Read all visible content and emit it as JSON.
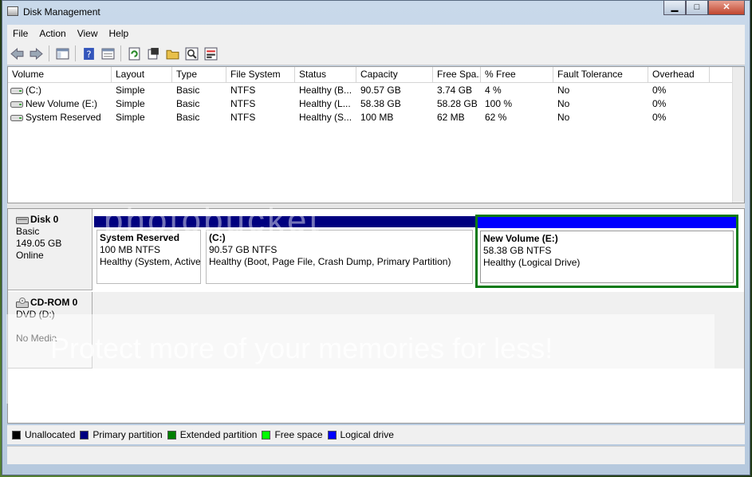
{
  "window": {
    "title": "Disk Management",
    "min": "▁",
    "max": "□",
    "close": "✕"
  },
  "menu": [
    "File",
    "Action",
    "View",
    "Help"
  ],
  "volumes": {
    "columns": [
      "Volume",
      "Layout",
      "Type",
      "File System",
      "Status",
      "Capacity",
      "Free Spa...",
      "% Free",
      "Fault Tolerance",
      "Overhead"
    ],
    "rows": [
      [
        "(C:)",
        "Simple",
        "Basic",
        "NTFS",
        "Healthy (B...",
        "90.57 GB",
        "3.74 GB",
        "4 %",
        "No",
        "0%"
      ],
      [
        "New Volume (E:)",
        "Simple",
        "Basic",
        "NTFS",
        "Healthy (L...",
        "58.38 GB",
        "58.28 GB",
        "100 %",
        "No",
        "0%"
      ],
      [
        "System Reserved",
        "Simple",
        "Basic",
        "NTFS",
        "Healthy (S...",
        "100 MB",
        "62 MB",
        "62 %",
        "No",
        "0%"
      ]
    ]
  },
  "disk0": {
    "name": "Disk 0",
    "type": "Basic",
    "size": "149.05 GB",
    "state": "Online"
  },
  "partitions": [
    {
      "name": "System Reserved",
      "size": "100 MB NTFS",
      "status": "Healthy (System, Active"
    },
    {
      "name": "(C:)",
      "size": "90.57 GB NTFS",
      "status": "Healthy (Boot, Page File, Crash Dump, Primary Partition)"
    },
    {
      "name": "New Volume  (E:)",
      "size": "58.38 GB NTFS",
      "status": "Healthy (Logical Drive)"
    }
  ],
  "cdrom": {
    "name": "CD-ROM 0",
    "drive": "DVD (D:)",
    "media": "No Media"
  },
  "legend": [
    {
      "label": "Unallocated",
      "color": "#000000"
    },
    {
      "label": "Primary partition",
      "color": "#00007f"
    },
    {
      "label": "Extended partition",
      "color": "#007f00"
    },
    {
      "label": "Free space",
      "color": "#00ff00"
    },
    {
      "label": "Logical drive",
      "color": "#0000ff"
    }
  ],
  "watermark": {
    "top": "photobucket",
    "bottom": "Protect more of your memories for less!"
  }
}
